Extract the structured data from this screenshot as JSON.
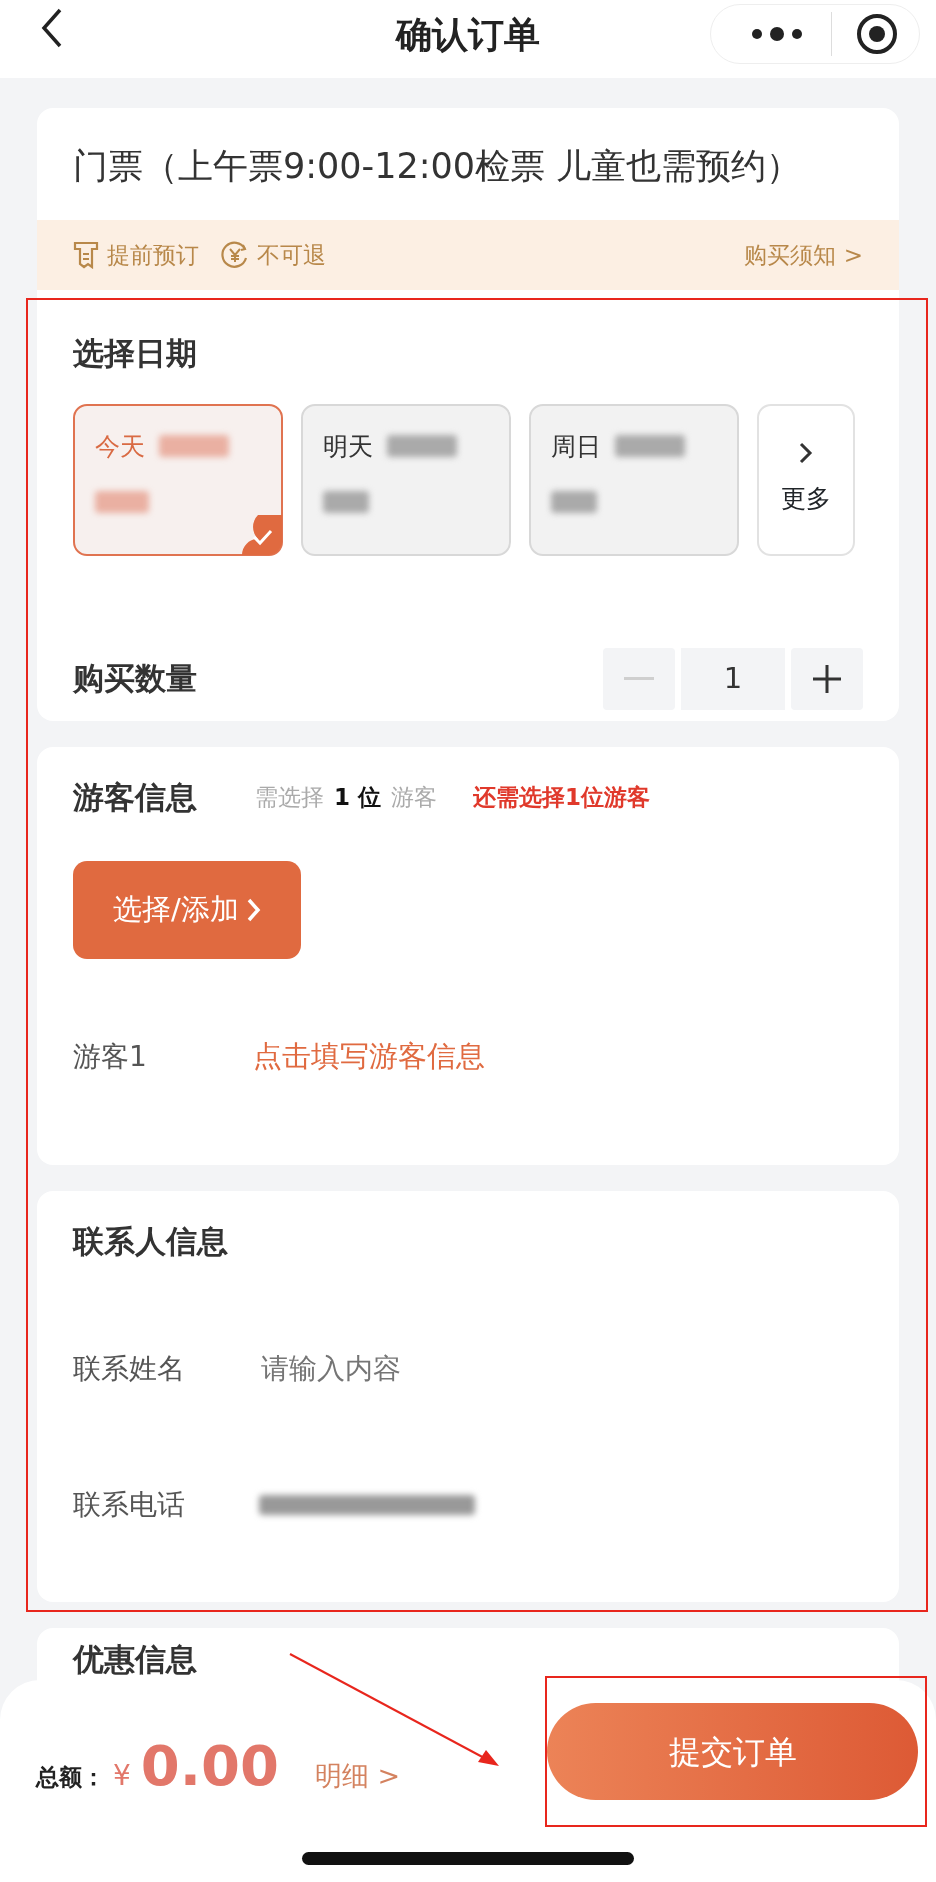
{
  "nav": {
    "title": "确认订单"
  },
  "ticket": {
    "title": "门票（上午票9:00-12:00检票 儿童也需预约）",
    "tags": [
      {
        "kind": "advance",
        "label": "提前预订"
      },
      {
        "kind": "refund",
        "label": "不可退"
      }
    ],
    "notice_link": "购买须知 >"
  },
  "date_section": {
    "heading": "选择日期",
    "dates": [
      {
        "label": "今天",
        "selected": true
      },
      {
        "label": "明天",
        "selected": false
      },
      {
        "label": "周日",
        "selected": false
      }
    ],
    "more": "更多"
  },
  "quantity": {
    "label": "购买数量",
    "value": "1",
    "minus_disabled": true
  },
  "visitors": {
    "heading": "游客信息",
    "need_prefix": "需选择",
    "need_count": "1 位",
    "need_suffix": "游客",
    "warning": "还需选择1位游客",
    "add_button": "选择/添加",
    "rows": [
      {
        "label": "游客1",
        "action": "点击填写游客信息"
      }
    ]
  },
  "contact": {
    "heading": "联系人信息",
    "fields": [
      {
        "label": "联系姓名",
        "placeholder": "请输入内容",
        "redacted": false
      },
      {
        "label": "联系电话",
        "redacted": true
      }
    ]
  },
  "discount": {
    "heading": "优惠信息"
  },
  "footer": {
    "total_label": "总额：",
    "currency": "¥",
    "amount": "0.00",
    "detail_link": "明细 >",
    "submit": "提交订单"
  }
}
